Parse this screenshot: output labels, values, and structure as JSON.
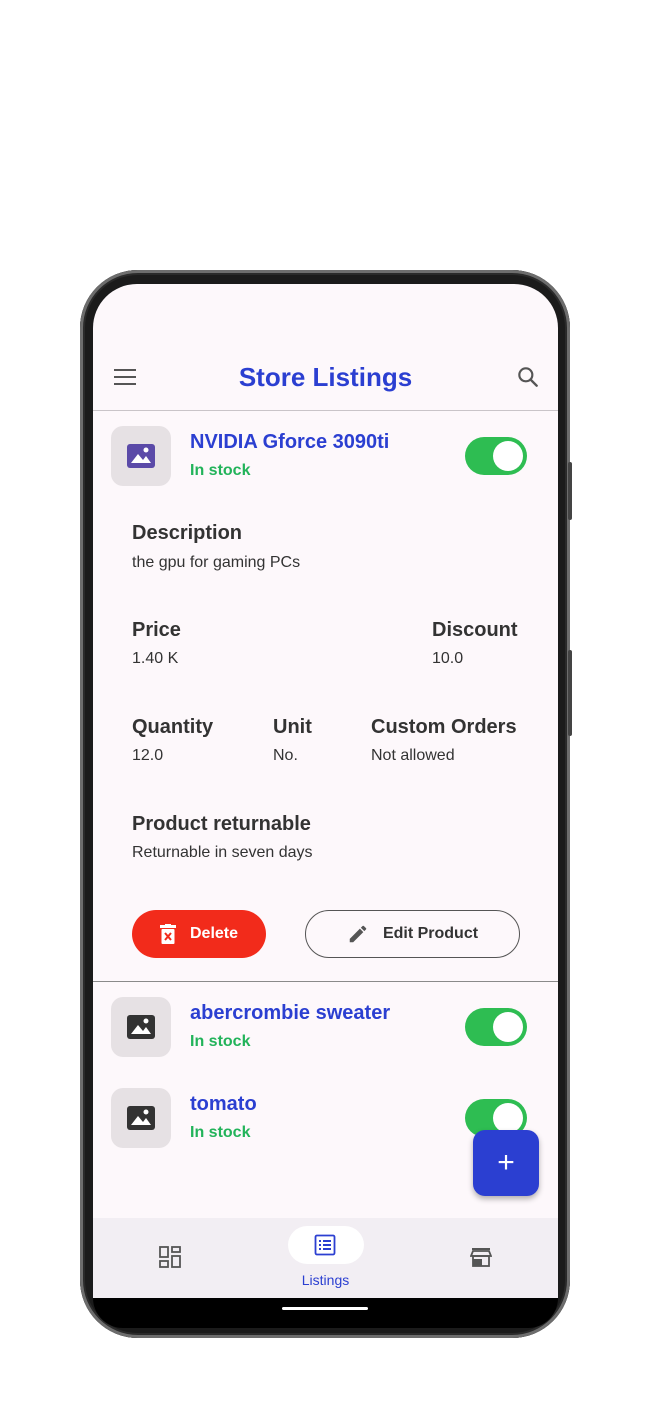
{
  "header": {
    "title": "Store Listings"
  },
  "products": [
    {
      "name": "NVIDIA Gforce 3090ti",
      "stock": "In stock",
      "enabled": true,
      "details": {
        "description_label": "Description",
        "description": "the gpu for gaming PCs",
        "price_label": "Price",
        "price": "1.40 K",
        "discount_label": "Discount",
        "discount": "10.0",
        "quantity_label": "Quantity",
        "quantity": "12.0",
        "unit_label": "Unit",
        "unit": "No.",
        "custom_orders_label": "Custom Orders",
        "custom_orders": "Not allowed",
        "returnable_label": "Product returnable",
        "returnable": "Returnable in seven days"
      },
      "actions": {
        "delete_label": "Delete",
        "edit_label": "Edit Product"
      }
    },
    {
      "name": "abercrombie sweater",
      "stock": "In stock",
      "enabled": true
    },
    {
      "name": "tomato",
      "stock": "In stock",
      "enabled": true
    }
  ],
  "fab": {
    "label": "+"
  },
  "bottom_nav": {
    "items": [
      {
        "icon": "dashboard-icon",
        "label": ""
      },
      {
        "icon": "listings-icon",
        "label": "Listings",
        "active": true
      },
      {
        "icon": "store-icon",
        "label": ""
      }
    ]
  },
  "colors": {
    "accent": "#2b3fd1",
    "stock": "#22b35a",
    "toggle": "#2ebd52",
    "delete": "#f22b1b"
  }
}
